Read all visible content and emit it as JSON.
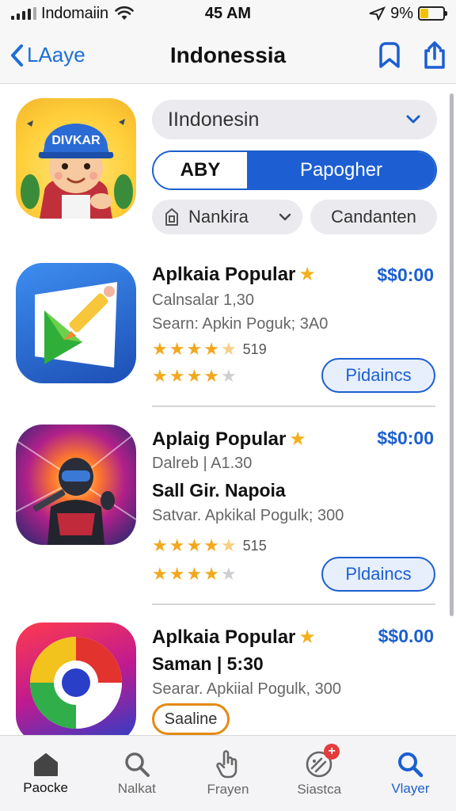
{
  "status_bar": {
    "carrier": "Indomaiin",
    "time": "45 AM",
    "battery_text": "9%",
    "battery_level": 0.35
  },
  "nav": {
    "back_label": "LAaye",
    "title": "Indonessia",
    "icons": [
      "bookmark-icon",
      "share-icon"
    ]
  },
  "featured": {
    "icon_text": "DIVKAR"
  },
  "filters": {
    "dropdown_value": "IIndonesin",
    "segments": [
      "ABY",
      "Papogher"
    ],
    "active_segment": 1,
    "chip_rank": "Nankira",
    "chip_candidate": "Candanten"
  },
  "apps": [
    {
      "title": "Aplkaia Popular",
      "price": "$$0:00",
      "line1": "Calnsalar 1,30",
      "line2": "Searn: Apkin Poguk; 3A0",
      "rating1": 4.5,
      "count1": "519",
      "rating2": 4,
      "button": "Pidaincs"
    },
    {
      "title": "Aplaig Popular",
      "price": "$$0:00",
      "line1": "Dalreb | A1.30",
      "line_strong": "Sall Gir. Napoia",
      "line2": "Satvar. Apkikal Pogulk; 300",
      "rating1": 4.5,
      "count1": "515",
      "rating2": 4,
      "button": "Pldaincs"
    },
    {
      "title": "Aplkaia Popular",
      "price": "$$0.00",
      "line_strong": "Saman | 5:30",
      "line2": "Searar. Apkiial Pogulk, 300",
      "badge": "Saaline"
    }
  ],
  "tabs": [
    {
      "label": "Paocke",
      "icon": "home-icon"
    },
    {
      "label": "Nalkat",
      "icon": "search-icon"
    },
    {
      "label": "Frayen",
      "icon": "hand-icon"
    },
    {
      "label": "Siastca",
      "icon": "game-icon",
      "badge": "+"
    },
    {
      "label": "Vlayer",
      "icon": "search-icon"
    }
  ],
  "colors": {
    "accent": "#1c5fd0",
    "star": "#f2a81d",
    "badge_outline": "#e58a12"
  }
}
